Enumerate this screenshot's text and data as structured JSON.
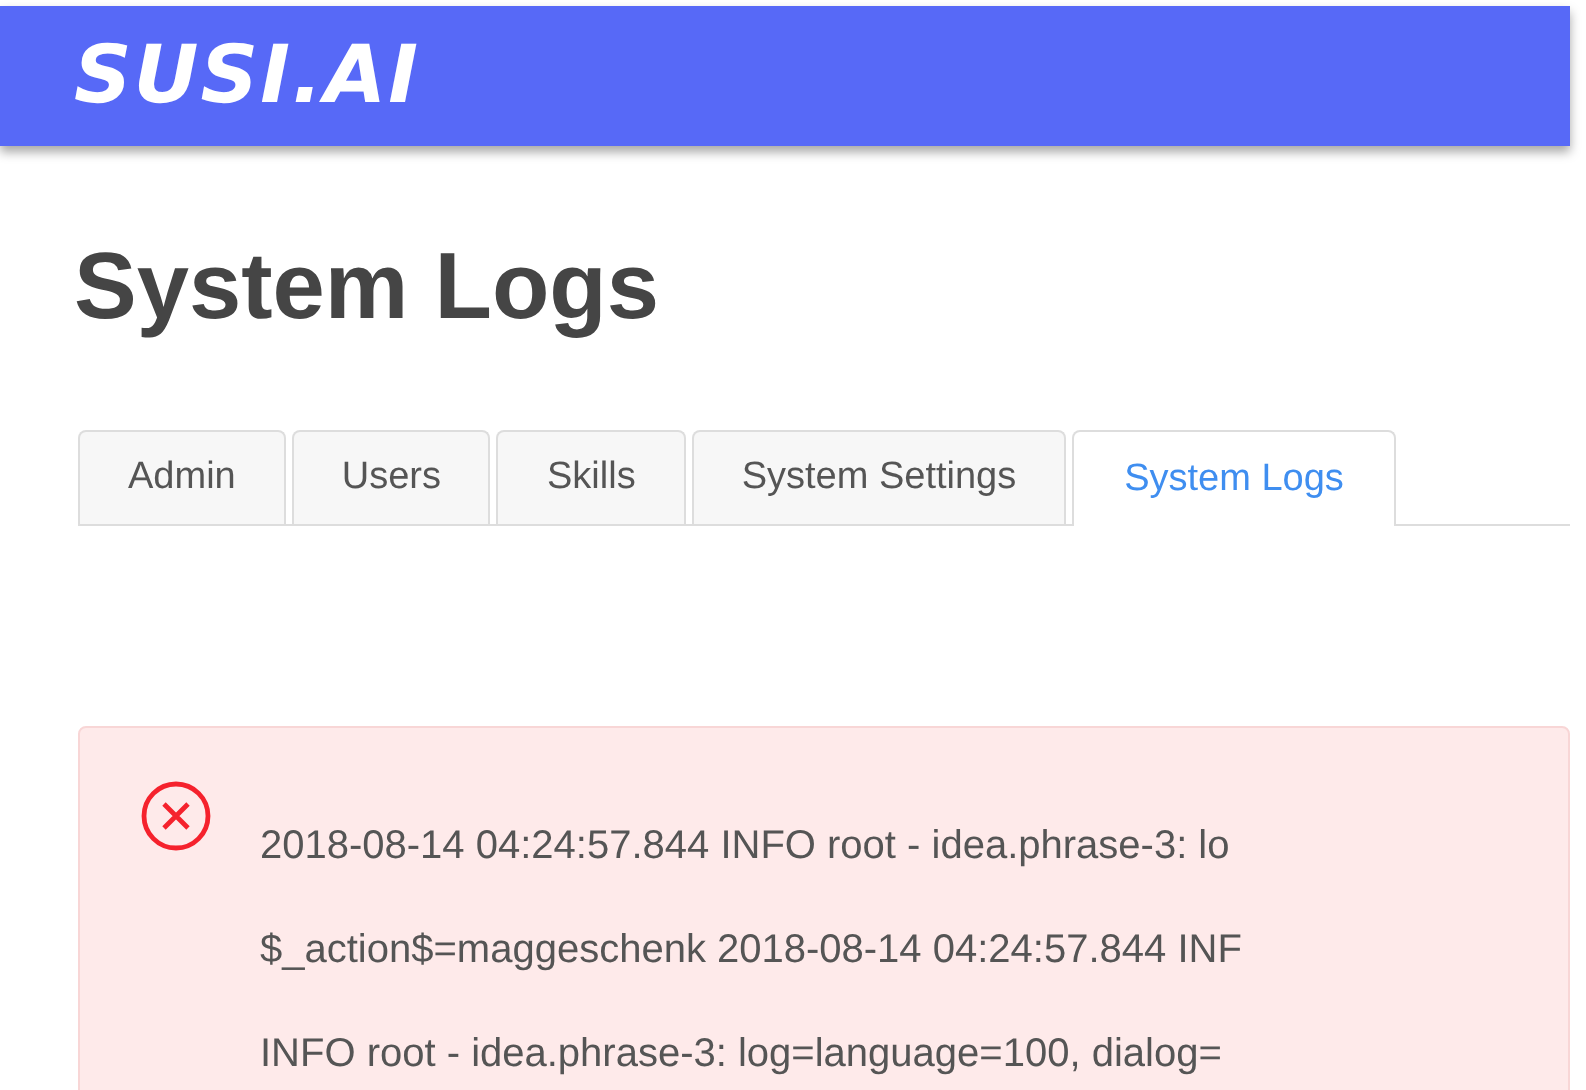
{
  "header": {
    "logo": "SUSI.AI"
  },
  "title": "System Logs",
  "tabs": [
    {
      "label": "Admin",
      "selected": false
    },
    {
      "label": "Users",
      "selected": false
    },
    {
      "label": "Skills",
      "selected": false
    },
    {
      "label": "System Settings",
      "selected": false
    },
    {
      "label": "System Logs",
      "selected": true
    }
  ],
  "alert": {
    "kind": "error",
    "lines": [
      "2018-08-14 04:24:57.844 INFO root - idea.phrase-3: lo",
      "$_action$=maggeschenk 2018-08-14 04:24:57.844 INF",
      "INFO root - idea.phrase-3: log=language=100, dialog="
    ]
  }
}
